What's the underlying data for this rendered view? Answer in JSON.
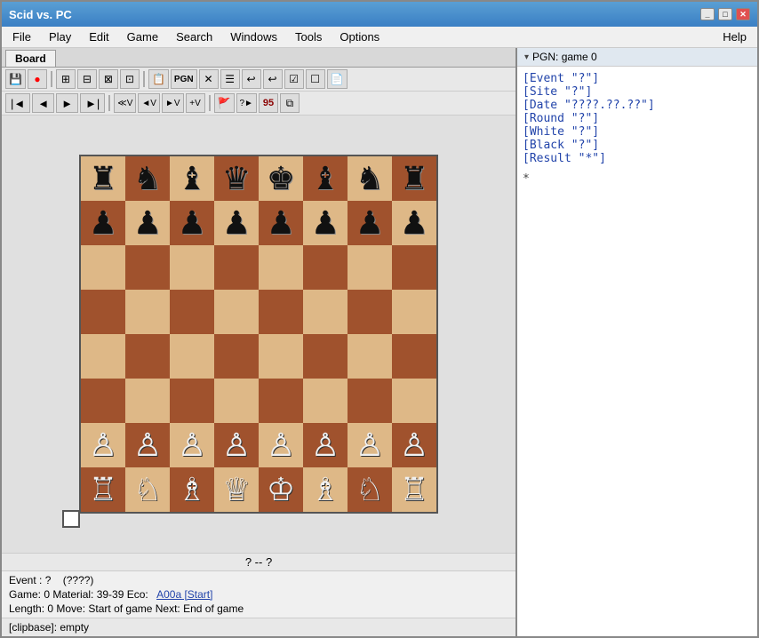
{
  "window": {
    "title": "Scid vs. PC",
    "controls": {
      "minimize": "_",
      "maximize": "□",
      "close": "✕"
    }
  },
  "menu": {
    "items": [
      "File",
      "Play",
      "Edit",
      "Game",
      "Search",
      "Windows",
      "Tools",
      "Options"
    ],
    "help": "Help"
  },
  "tabs": {
    "board": "Board"
  },
  "toolbar1": {
    "buttons": [
      "💾",
      "🔴",
      "⊞",
      "⊟",
      "⊠",
      "⊡",
      "📋",
      "PGN",
      "✕",
      "☰",
      "↩",
      "↩",
      "☑",
      "☐",
      "📄"
    ]
  },
  "toolbar2": {
    "buttons": [
      "|◄",
      "◄",
      "►",
      "►|",
      "≪V",
      "◄V",
      "►V",
      "+V",
      "🚩",
      "?►",
      "95",
      "⧉"
    ]
  },
  "board": {
    "pieces": [
      [
        "♜",
        "♞",
        "♝",
        "♛",
        "♚",
        "♝",
        "♞",
        "♜"
      ],
      [
        "♟",
        "♟",
        "♟",
        "♟",
        "♟",
        "♟",
        "♟",
        "♟"
      ],
      [
        "",
        "",
        "",
        "",
        "",
        "",
        "",
        ""
      ],
      [
        "",
        "",
        "",
        "",
        "",
        "",
        "",
        ""
      ],
      [
        "",
        "",
        "",
        "",
        "",
        "",
        "",
        ""
      ],
      [
        "",
        "",
        "",
        "",
        "",
        "",
        "",
        ""
      ],
      [
        "♙",
        "♙",
        "♙",
        "♙",
        "♙",
        "♙",
        "♙",
        "♙"
      ],
      [
        "♖",
        "♘",
        "♗",
        "♕",
        "♔",
        "♗",
        "♘",
        "♖"
      ]
    ]
  },
  "status": {
    "line1_event": "Event : ?",
    "line1_date": "(????)",
    "line2": "Game:  0   Material: 39-39   Eco:",
    "eco_link": "A00a [Start]",
    "line3": "Length:  0   Move:  Start of game   Next:  End of game",
    "center_text": "?   --   ?"
  },
  "clipbase": "[clipbase]:  empty",
  "pgn": {
    "header_label": "PGN: game 0",
    "tags": [
      "[Event \"?\"]",
      "[Site \"?\"]",
      "[Date \"????.??.??\"]",
      "[Round \"?\"]",
      "[White \"?\"]",
      "[Black \"?\"]",
      "[Result \"*\"]"
    ],
    "dot": "*"
  }
}
